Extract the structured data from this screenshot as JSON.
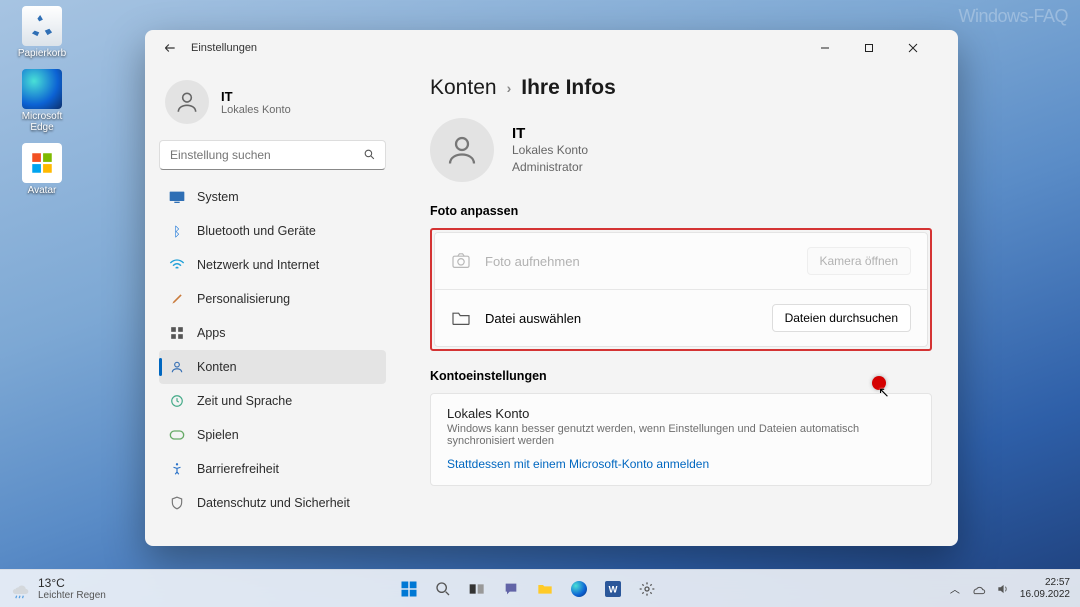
{
  "watermark": "Windows-FAQ",
  "desktop": {
    "recycle": "Papierkorb",
    "edge": "Microsoft Edge",
    "avatar": "Avatar"
  },
  "window": {
    "title": "Einstellungen",
    "minimize": "–",
    "maximize": "□",
    "close": "✕",
    "user": {
      "name": "IT",
      "sub": "Lokales Konto"
    },
    "search_placeholder": "Einstellung suchen",
    "nav": {
      "system": "System",
      "bluetooth": "Bluetooth und Geräte",
      "network": "Netzwerk und Internet",
      "personal": "Personalisierung",
      "apps": "Apps",
      "accounts": "Konten",
      "time": "Zeit und Sprache",
      "gaming": "Spielen",
      "access": "Barrierefreiheit",
      "privacy": "Datenschutz und Sicherheit"
    },
    "breadcrumb": {
      "parent": "Konten",
      "current": "Ihre Infos"
    },
    "profile": {
      "name": "IT",
      "sub1": "Lokales Konto",
      "sub2": "Administrator"
    },
    "photo_section": "Foto anpassen",
    "photo_take": {
      "label": "Foto aufnehmen",
      "action": "Kamera öffnen"
    },
    "photo_file": {
      "label": "Datei auswählen",
      "action": "Dateien durchsuchen"
    },
    "account_section": "Kontoeinstellungen",
    "local": {
      "title": "Lokales Konto",
      "desc": "Windows kann besser genutzt werden, wenn Einstellungen und Dateien automatisch synchronisiert werden",
      "link": "Stattdessen mit einem Microsoft-Konto anmelden"
    }
  },
  "taskbar": {
    "temp": "13°C",
    "weather": "Leichter Regen",
    "time": "22:57",
    "date": "16.09.2022"
  }
}
